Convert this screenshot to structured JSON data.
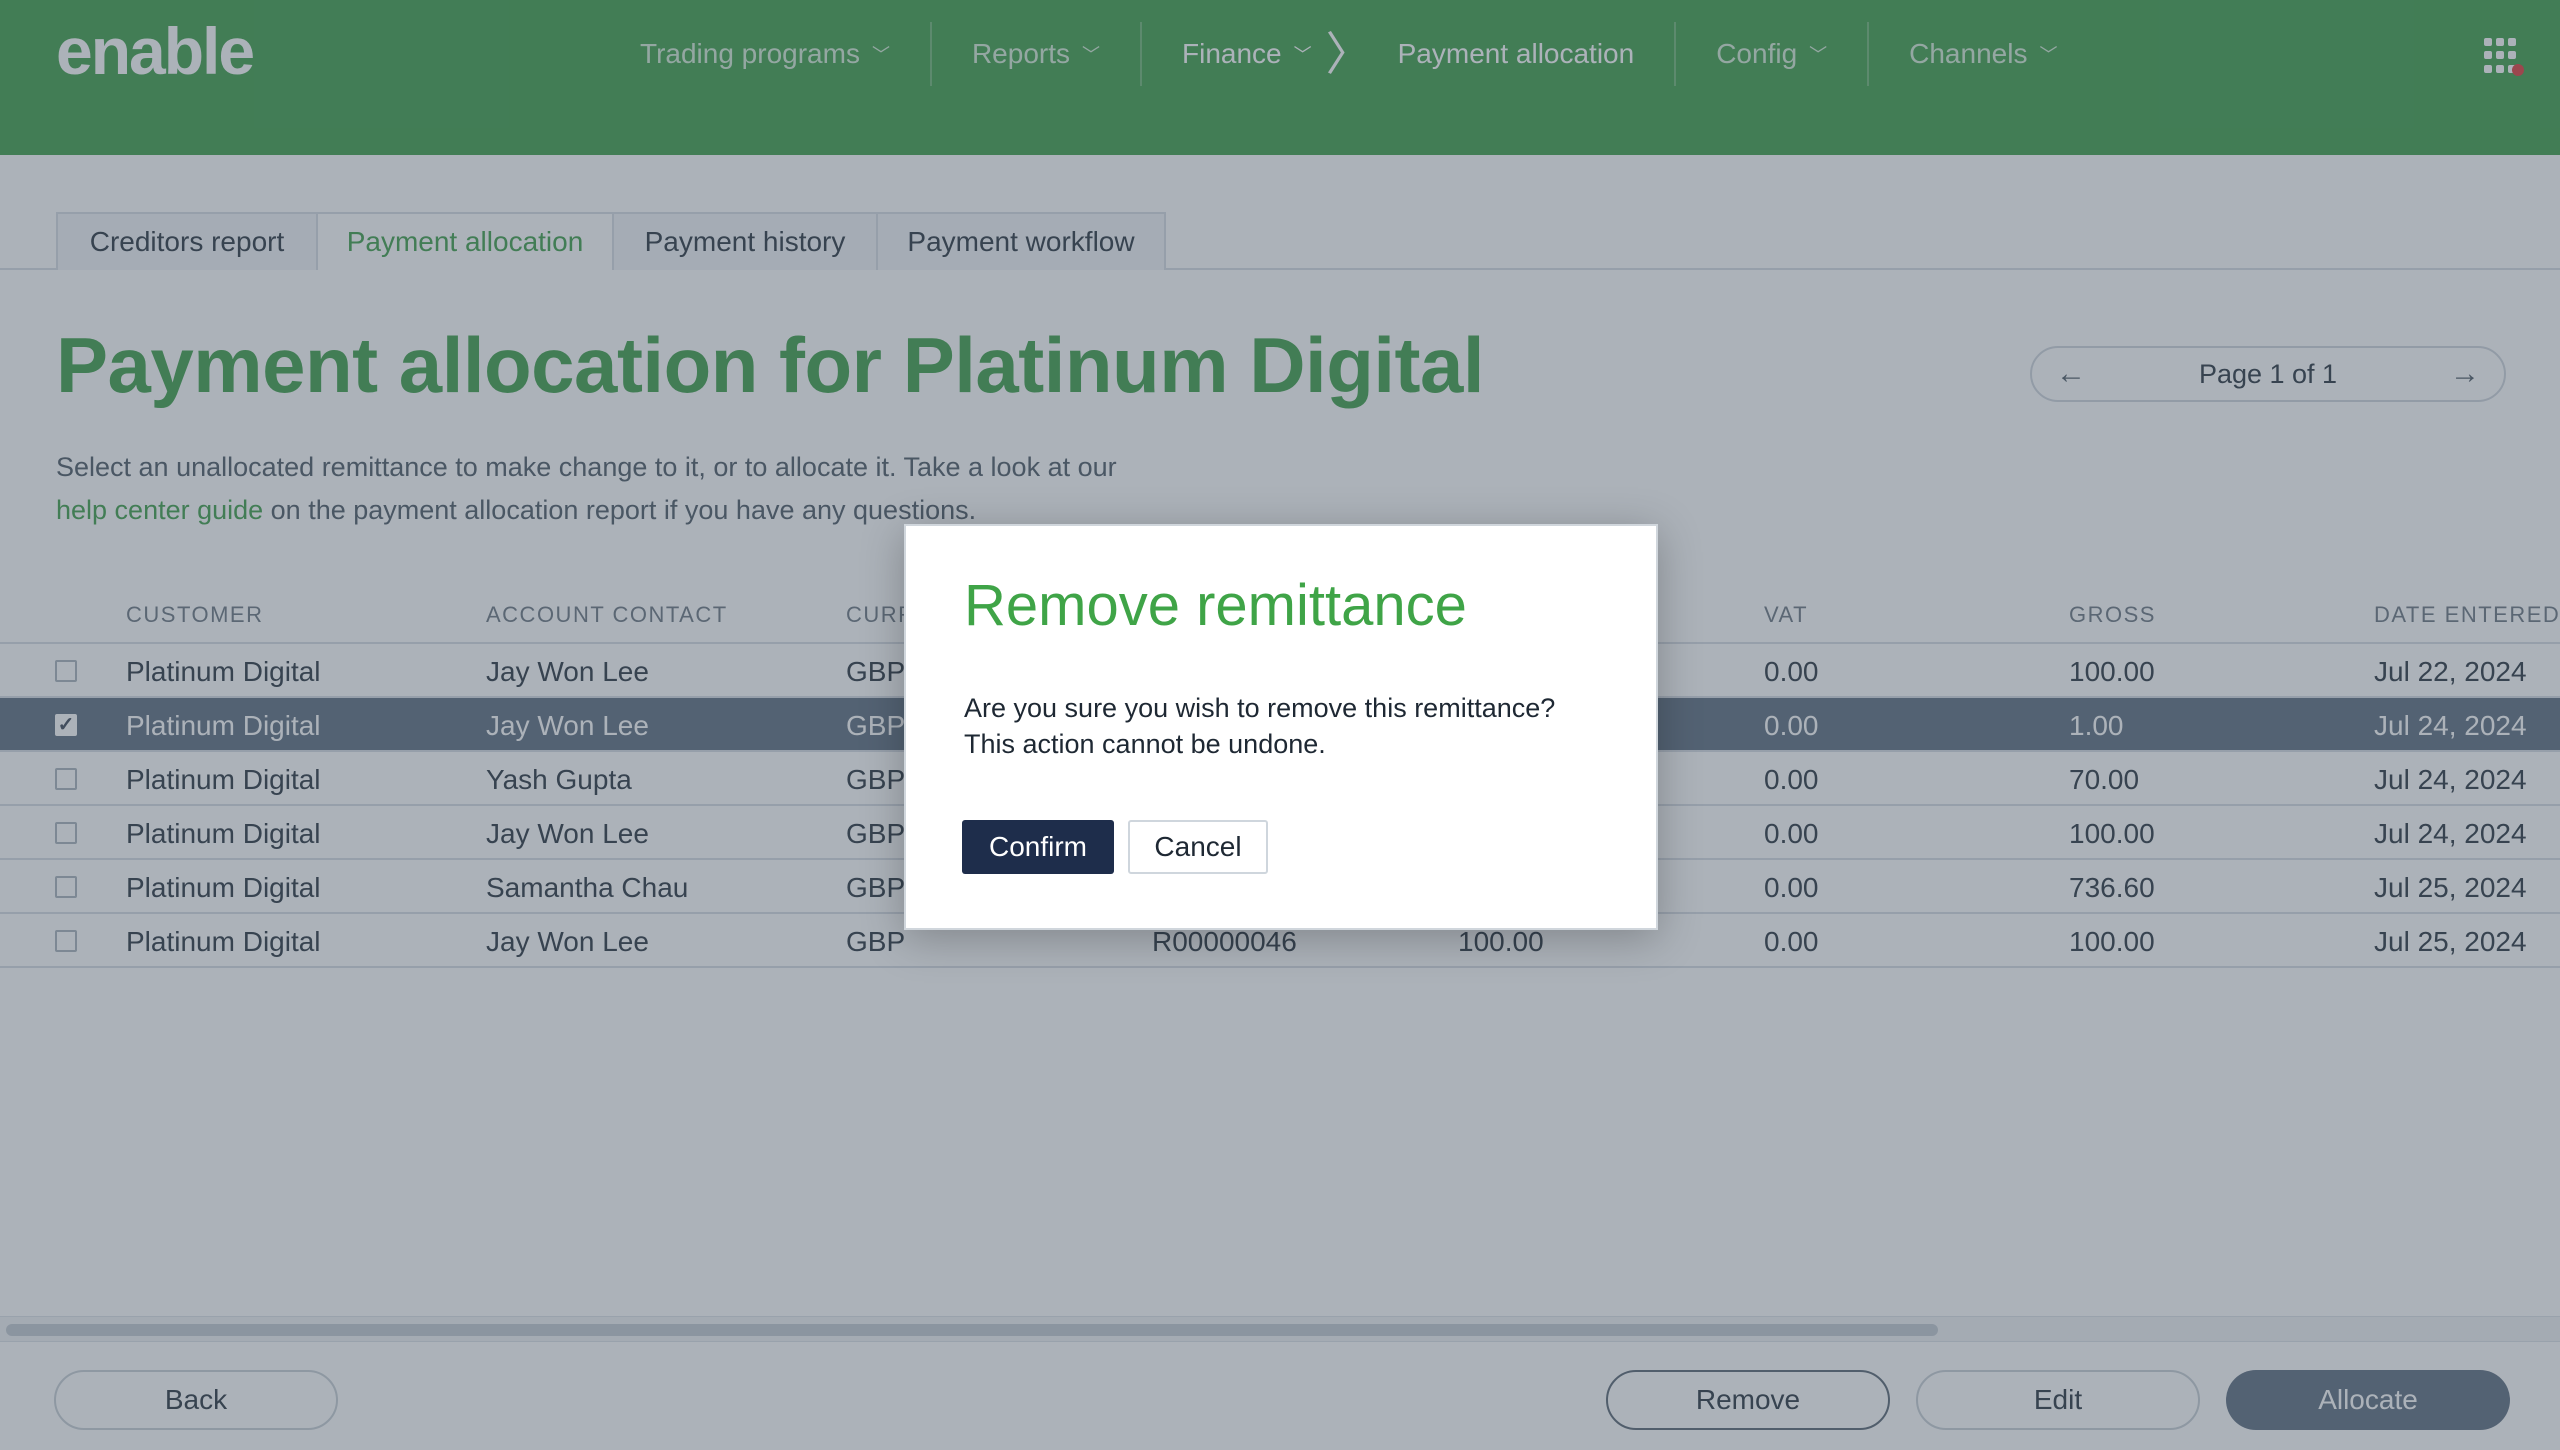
{
  "header": {
    "logo_text": "enable",
    "nav": [
      {
        "label": "Trading programs"
      },
      {
        "label": "Reports"
      },
      {
        "label": "Finance"
      },
      {
        "label": "Config"
      },
      {
        "label": "Channels"
      }
    ],
    "breadcrumb_current": "Payment allocation"
  },
  "tabs": [
    {
      "label": "Creditors report"
    },
    {
      "label": "Payment allocation"
    },
    {
      "label": "Payment history"
    },
    {
      "label": "Payment workflow"
    }
  ],
  "page": {
    "title": "Payment allocation for Platinum Digital",
    "desc_before": "Select an unallocated remittance to make change to it, or to allocate it. Take a look at our ",
    "desc_link": "help center guide",
    "desc_after": " on the payment allocation report if you have any questions."
  },
  "pager": {
    "label": "Page 1 of 1"
  },
  "table": {
    "headers": [
      "CUSTOMER",
      "ACCOUNT CONTACT",
      "CURRENCY",
      "VAT",
      "GROSS",
      "DATE ENTERED"
    ],
    "header_currency_visible": "CURR",
    "rows": [
      {
        "customer": "Platinum Digital",
        "contact": "Jay Won Lee",
        "currency": "GBP",
        "reference": "",
        "net": "",
        "vat": "0.00",
        "gross": "100.00",
        "date": "Jul 22, 2024",
        "selected": false
      },
      {
        "customer": "Platinum Digital",
        "contact": "Jay Won Lee",
        "currency": "GBP",
        "reference": "",
        "net": "",
        "vat": "0.00",
        "gross": "1.00",
        "date": "Jul 24, 2024",
        "selected": true
      },
      {
        "customer": "Platinum Digital",
        "contact": "Yash Gupta",
        "currency": "GBP",
        "reference": "",
        "net": "",
        "vat": "0.00",
        "gross": "70.00",
        "date": "Jul 24, 2024",
        "selected": false
      },
      {
        "customer": "Platinum Digital",
        "contact": "Jay Won Lee",
        "currency": "GBP",
        "reference": "",
        "net": "",
        "vat": "0.00",
        "gross": "100.00",
        "date": "Jul 24, 2024",
        "selected": false
      },
      {
        "customer": "Platinum Digital",
        "contact": "Samantha Chau",
        "currency": "GBP",
        "reference": "",
        "net": "",
        "vat": "0.00",
        "gross": "736.60",
        "date": "Jul 25, 2024",
        "selected": false
      },
      {
        "customer": "Platinum Digital",
        "contact": "Jay Won Lee",
        "currency": "GBP",
        "reference": "R00000046",
        "net": "100.00",
        "vat": "0.00",
        "gross": "100.00",
        "date": "Jul 25, 2024",
        "selected": false
      }
    ]
  },
  "footer": {
    "back_label": "Back",
    "remove_label": "Remove",
    "edit_label": "Edit",
    "allocate_label": "Allocate"
  },
  "modal": {
    "title": "Remove remittance",
    "line1": "Are you sure you wish to remove this remittance?",
    "line2": "This action cannot be undone.",
    "confirm_label": "Confirm",
    "cancel_label": "Cancel"
  },
  "colors": {
    "brand_green": "#3f9e4a",
    "selected_row": "#5e6e80",
    "confirm_button": "#1e2d4b"
  }
}
